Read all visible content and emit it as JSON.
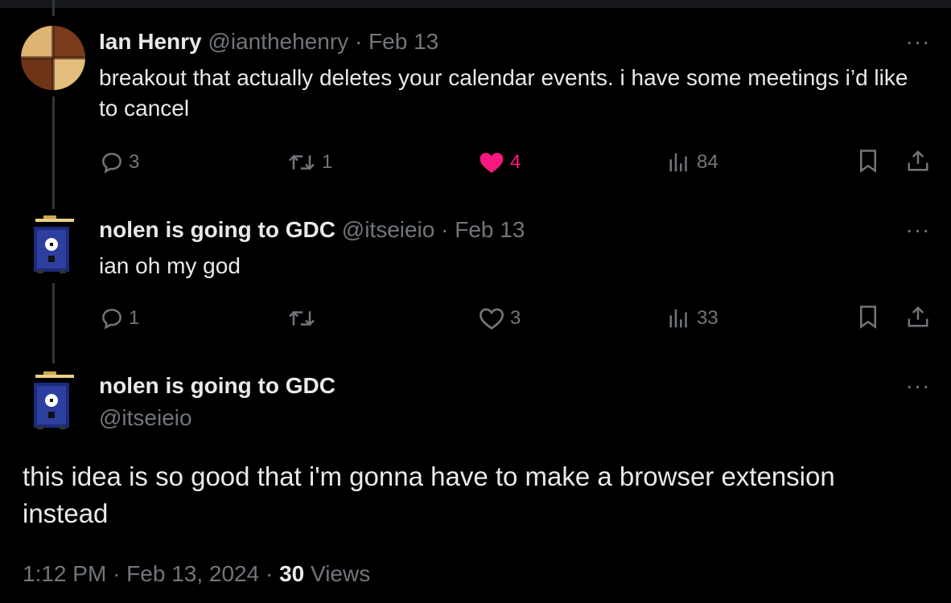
{
  "tweets": [
    {
      "display_name": "Ian Henry",
      "handle": "@ianthehenry",
      "separator": "·",
      "date": "Feb 13",
      "text": "breakout that actually deletes your calendar events. i have some meetings i’d like to cancel",
      "replies": "3",
      "reposts": "1",
      "likes": "4",
      "views": "84",
      "liked": true
    },
    {
      "display_name": "nolen is going to GDC",
      "handle": "@itseieio",
      "separator": "·",
      "date": "Feb 13",
      "text": "ian oh my god",
      "replies": "1",
      "reposts": "",
      "likes": "3",
      "views": "33",
      "liked": false
    }
  ],
  "main_tweet": {
    "display_name": "nolen is going to GDC",
    "handle": "@itseieio",
    "text": "this idea is so good that i'm gonna have to make a browser extension instead",
    "time": "1:12 PM",
    "separator": "·",
    "date": "Feb 13, 2024",
    "views_count": "30",
    "views_label": "Views"
  },
  "more_glyph": "···",
  "icons": {
    "reply": "reply-icon",
    "repost": "repost-icon",
    "like": "heart-icon",
    "views": "views-chart-icon",
    "bookmark": "bookmark-icon",
    "share": "share-icon"
  },
  "colors": {
    "background": "#000000",
    "text": "#e7e9ea",
    "muted": "#71767b",
    "like_active": "#f91880",
    "thread_line": "#333639"
  }
}
